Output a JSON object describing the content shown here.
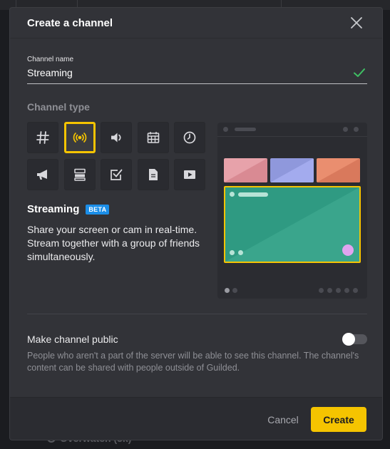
{
  "dialog": {
    "title": "Create a channel"
  },
  "channel_name": {
    "label": "Channel name",
    "value": "Streaming"
  },
  "channel_type": {
    "section_title": "Channel type",
    "types": [
      {
        "icon": "hash-icon",
        "selected": false
      },
      {
        "icon": "broadcast-icon",
        "selected": true
      },
      {
        "icon": "speaker-icon",
        "selected": false
      },
      {
        "icon": "calendar-icon",
        "selected": false
      },
      {
        "icon": "clock-icon",
        "selected": false
      },
      {
        "icon": "megaphone-icon",
        "selected": false
      },
      {
        "icon": "list-icon",
        "selected": false
      },
      {
        "icon": "checkbox-icon",
        "selected": false
      },
      {
        "icon": "document-icon",
        "selected": false
      },
      {
        "icon": "play-icon",
        "selected": false
      }
    ]
  },
  "selected_type": {
    "name": "Streaming",
    "badge": "BETA",
    "description": "Share your screen or cam in real-time. Stream together with a group of friends simultaneously."
  },
  "public": {
    "label": "Make channel public",
    "enabled": false,
    "help": "People who aren't a part of the server will be able to see this channel. The channel's content can be shared with people outside of Guilded."
  },
  "footer": {
    "cancel_label": "Cancel",
    "create_label": "Create"
  },
  "background": {
    "bottom_text": "Overwatch (5k)"
  },
  "colors": {
    "accent": "#f5c400",
    "beta_badge": "#1b8ee8",
    "valid_check": "#3fbf63",
    "modal_bg": "#323338"
  }
}
